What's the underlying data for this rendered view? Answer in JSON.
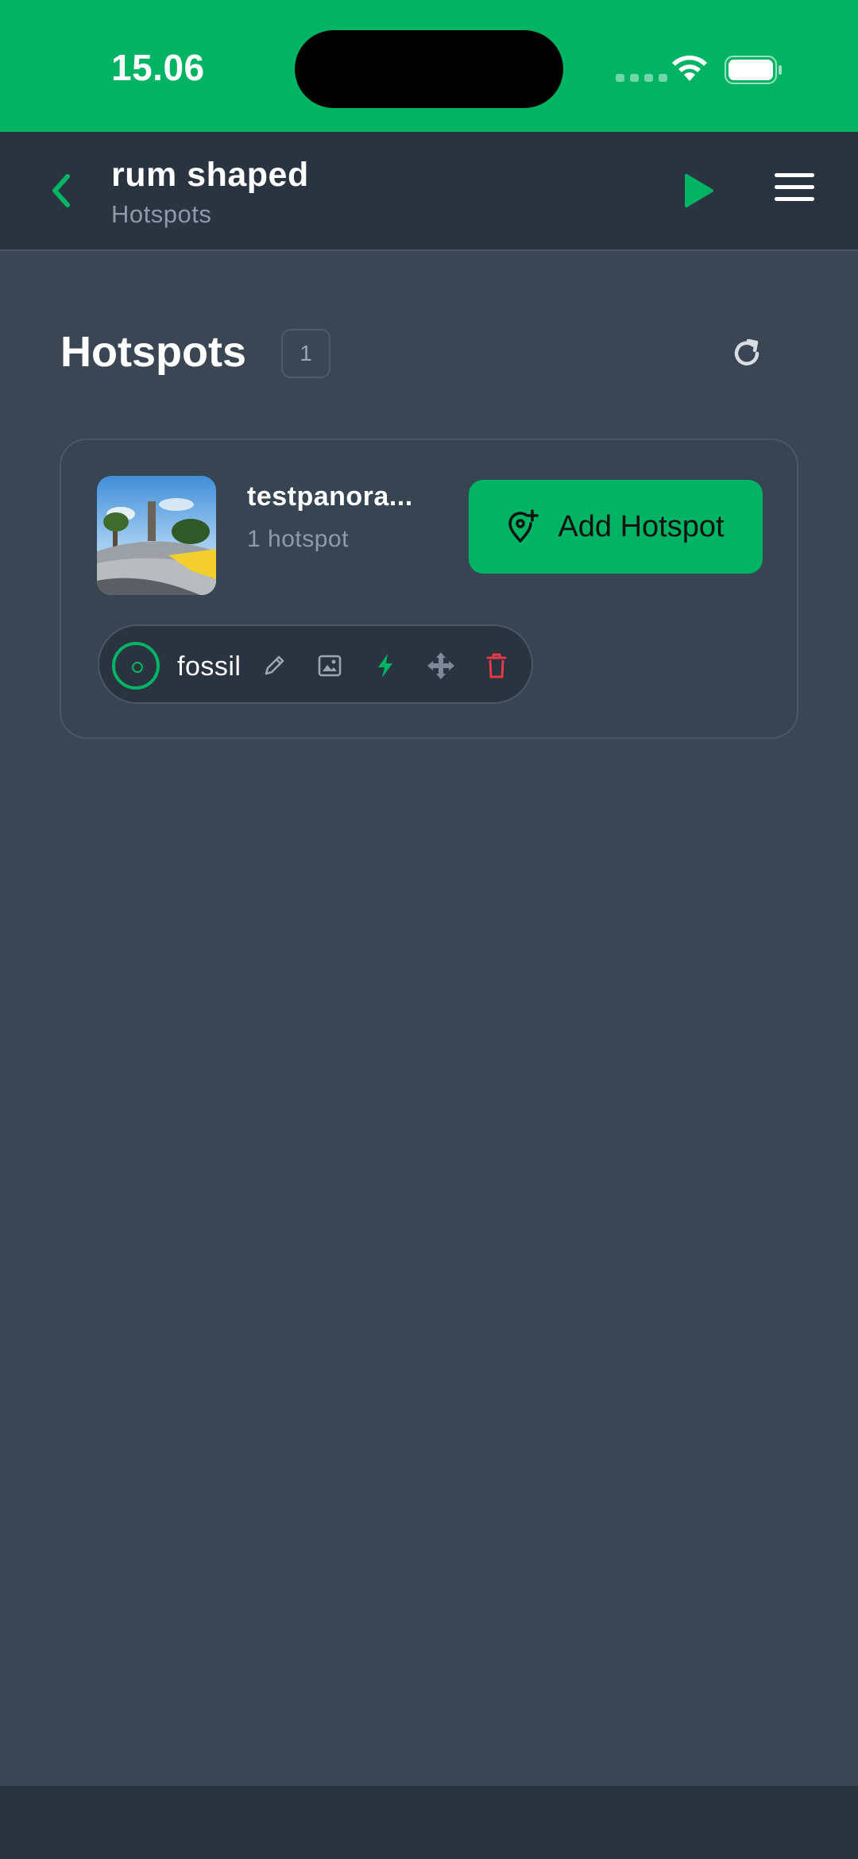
{
  "status_bar": {
    "time": "15.06",
    "bg_color": "#00b464"
  },
  "header": {
    "title": "rum shaped",
    "subtitle": "Hotspots",
    "back_icon": "chevron-left-icon",
    "play_icon": "play-icon",
    "menu_icon": "hamburger-menu-icon"
  },
  "section": {
    "title": "Hotspots",
    "count": "1",
    "refresh_icon": "refresh-icon"
  },
  "panorama": {
    "name": "testpanora...",
    "hotspot_count": "1 hotspot",
    "add_button_label": "Add Hotspot",
    "hotspots": [
      {
        "name": "fossil"
      }
    ]
  },
  "colors": {
    "accent": "#00b464",
    "header_bg": "#2a3441",
    "page_bg": "#3a4654",
    "danger": "#e53945"
  }
}
